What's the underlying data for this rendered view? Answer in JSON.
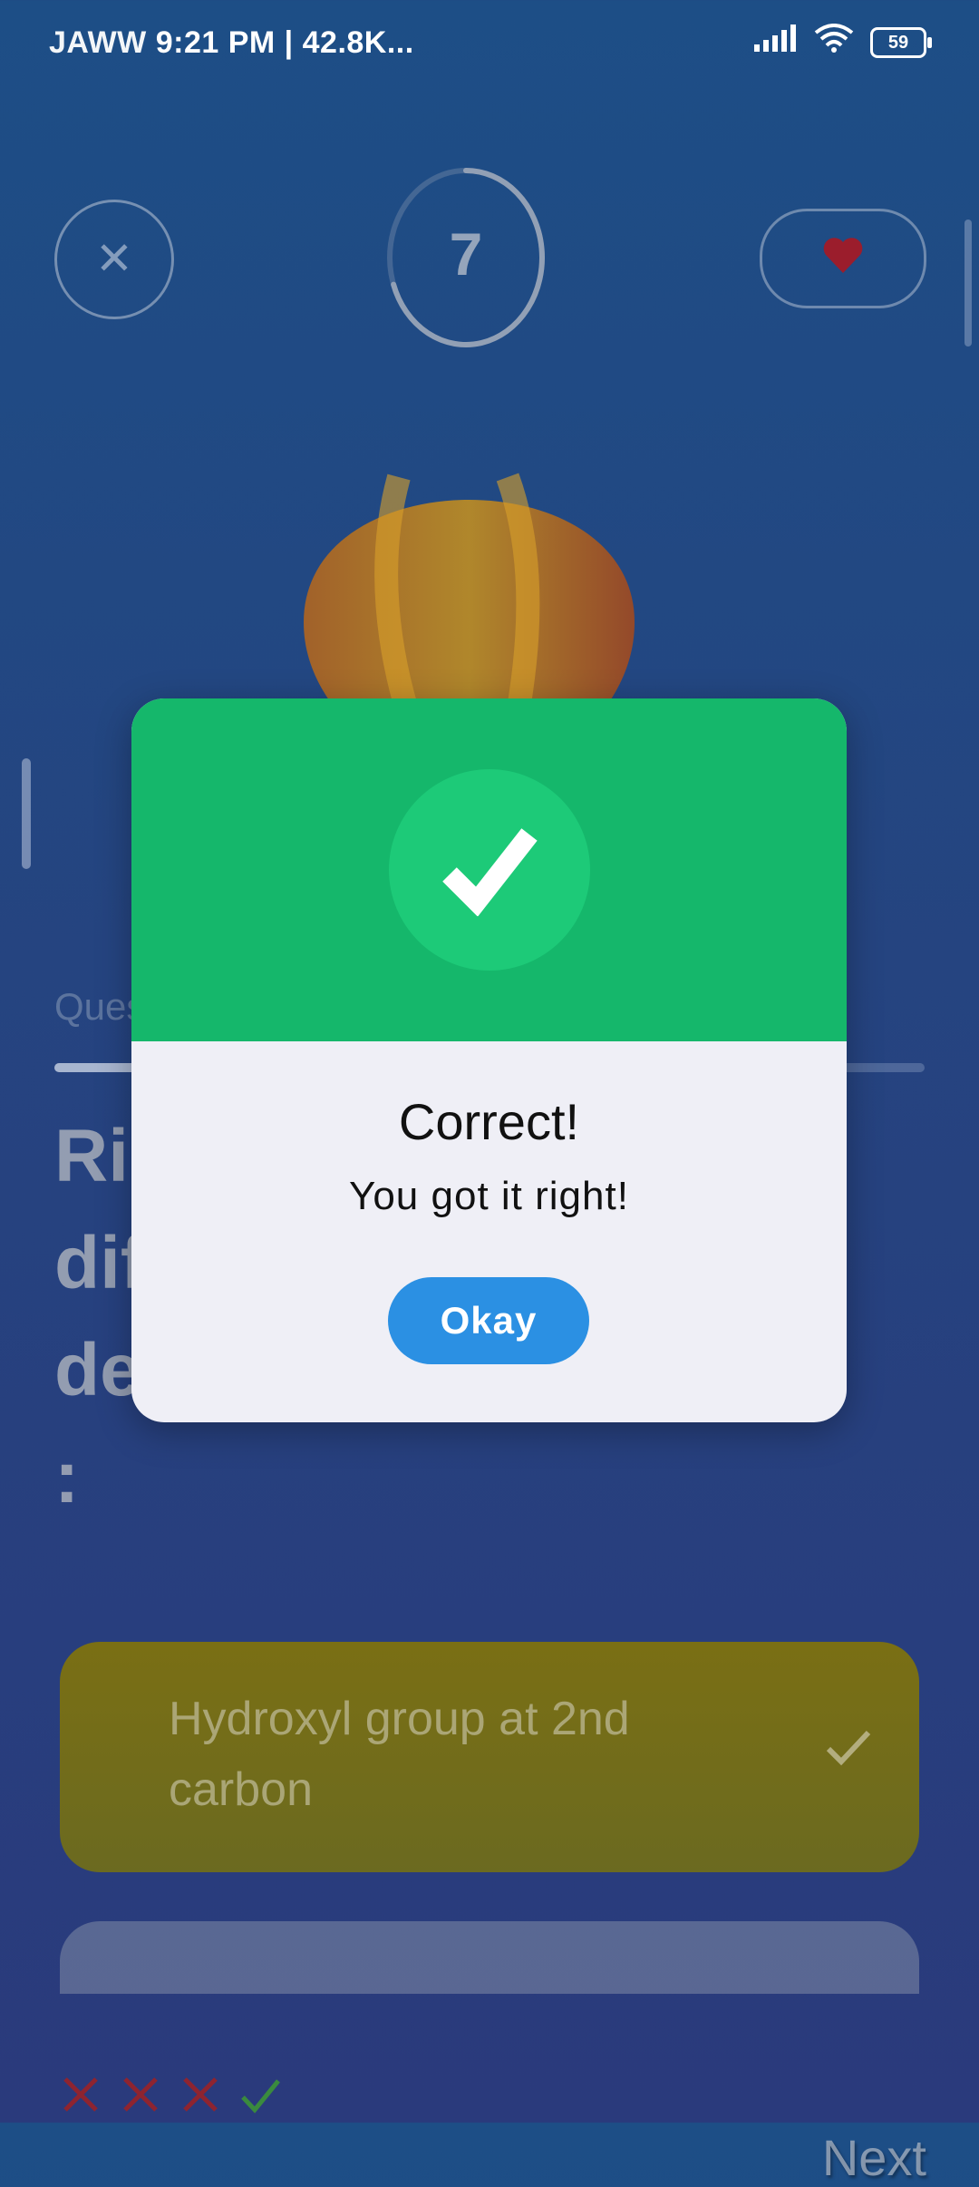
{
  "status_bar": {
    "carrier": "JAWW",
    "time_speed": "9:21 PM | 42.8K...",
    "battery": "59"
  },
  "quiz": {
    "timer_value": "7",
    "timer_fraction": 0.7,
    "question_counter": "Question 4 of 10",
    "progress_fraction": 0.4,
    "question_text": "Ribose is differentiable from deoxyribose in having :",
    "answers": [
      {
        "text": "Hydroxyl group at 2nd carbon",
        "color": "#7a6f14"
      }
    ],
    "attempt_marks": [
      "wrong",
      "wrong",
      "wrong",
      "correct"
    ],
    "next_label": "Next"
  },
  "dialog": {
    "title": "Correct!",
    "message": "You got it right!",
    "button_label": "Okay",
    "header_color": "#15b76b",
    "button_color": "#2b90e3"
  }
}
